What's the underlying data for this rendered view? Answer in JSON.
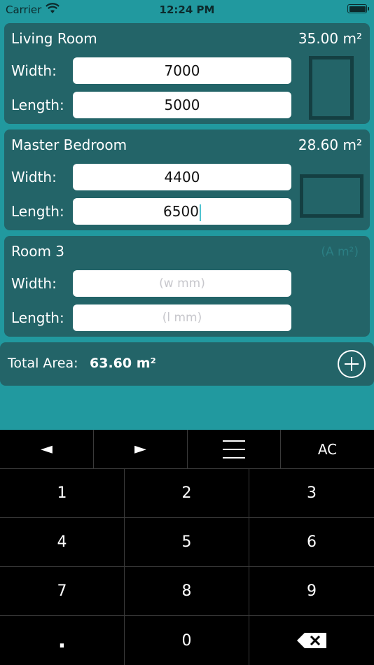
{
  "status_bar": {
    "carrier": "Carrier",
    "time": "12:24 PM"
  },
  "rooms": [
    {
      "name": "Living Room",
      "area": "35.00 m²",
      "width_label": "Width:",
      "length_label": "Length:",
      "width_value": "7000",
      "length_value": "5000"
    },
    {
      "name": "Master Bedroom",
      "area": "28.60 m²",
      "width_label": "Width:",
      "length_label": "Length:",
      "width_value": "4400",
      "length_value": "6500"
    },
    {
      "name": "Room 3",
      "area_placeholder": "(A m²)",
      "width_label": "Width:",
      "length_label": "Length:",
      "width_placeholder": "(w mm)",
      "length_placeholder": "(l mm)"
    }
  ],
  "total": {
    "label": "Total Area:",
    "value": "63.60 m²"
  },
  "keyboard": {
    "toolbar": [
      "◄",
      "►",
      "menu-icon",
      "AC"
    ],
    "digits": [
      "1",
      "2",
      "3",
      "4",
      "5",
      "6",
      "7",
      "8",
      "9",
      ".",
      "0"
    ],
    "backspace_icon": "backspace-icon"
  },
  "colors": {
    "background": "#21999f",
    "card": "#236468",
    "shape": "#143f42",
    "keyboard": "#000000"
  }
}
